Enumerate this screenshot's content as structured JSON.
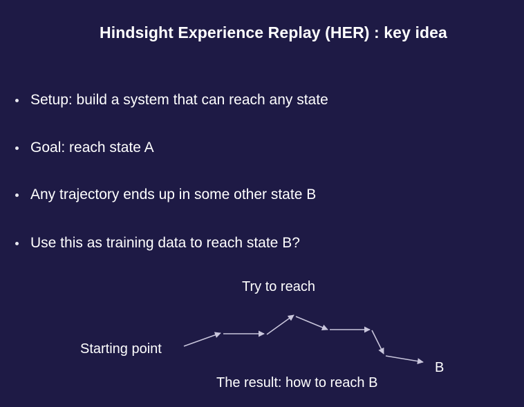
{
  "title": "Hindsight Experience Replay (HER) : key idea",
  "bullets": [
    "Setup: build a system that can reach any state",
    "Goal: reach state A",
    "Any trajectory ends up in some other state B",
    "Use this as training data to reach state B?"
  ],
  "diagram": {
    "try_to_reach": "Try to reach",
    "starting_point": "Starting point",
    "end_label": "B",
    "result": "The result: how to reach B",
    "arrow_color": "#c9c6dc"
  },
  "colors": {
    "background": "#1e1a45",
    "text": "#ffffff"
  }
}
